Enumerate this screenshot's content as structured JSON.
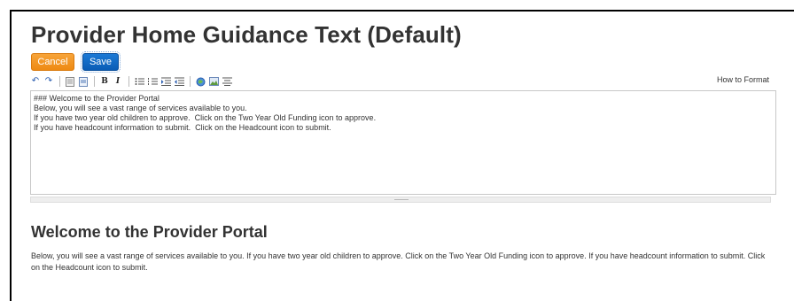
{
  "page": {
    "title": "Provider Home Guidance Text (Default)"
  },
  "actions": {
    "cancel_label": "Cancel",
    "save_label": "Save"
  },
  "toolbar": {
    "icons": [
      "undo-icon",
      "redo-icon",
      "insert-page-icon",
      "insert-section-icon",
      "bold-icon",
      "italic-icon",
      "bulleted-list-icon",
      "numbered-list-icon",
      "indent-icon",
      "outdent-icon",
      "link-icon",
      "image-icon",
      "align-icon"
    ],
    "bold_glyph": "B",
    "italic_glyph": "I",
    "how_to_format": "How to Format"
  },
  "editor": {
    "lines": [
      "### Welcome to the Provider Portal",
      "Below, you will see a vast range of services available to you.",
      "If you have two year old children to approve.  Click on the Two Year Old Funding icon to approve.",
      "If you have headcount information to submit.  Click on the Headcount icon to submit."
    ]
  },
  "preview": {
    "heading": "Welcome to the Provider Portal",
    "body": "Below, you will see a vast range of services available to you. If you have two year old children to approve. Click on the Two Year Old Funding icon to approve. If you have headcount information to submit. Click on the Headcount icon to submit."
  },
  "colors": {
    "cancel": "#ee8a12",
    "save": "#0a5cb5",
    "text": "#333333"
  }
}
